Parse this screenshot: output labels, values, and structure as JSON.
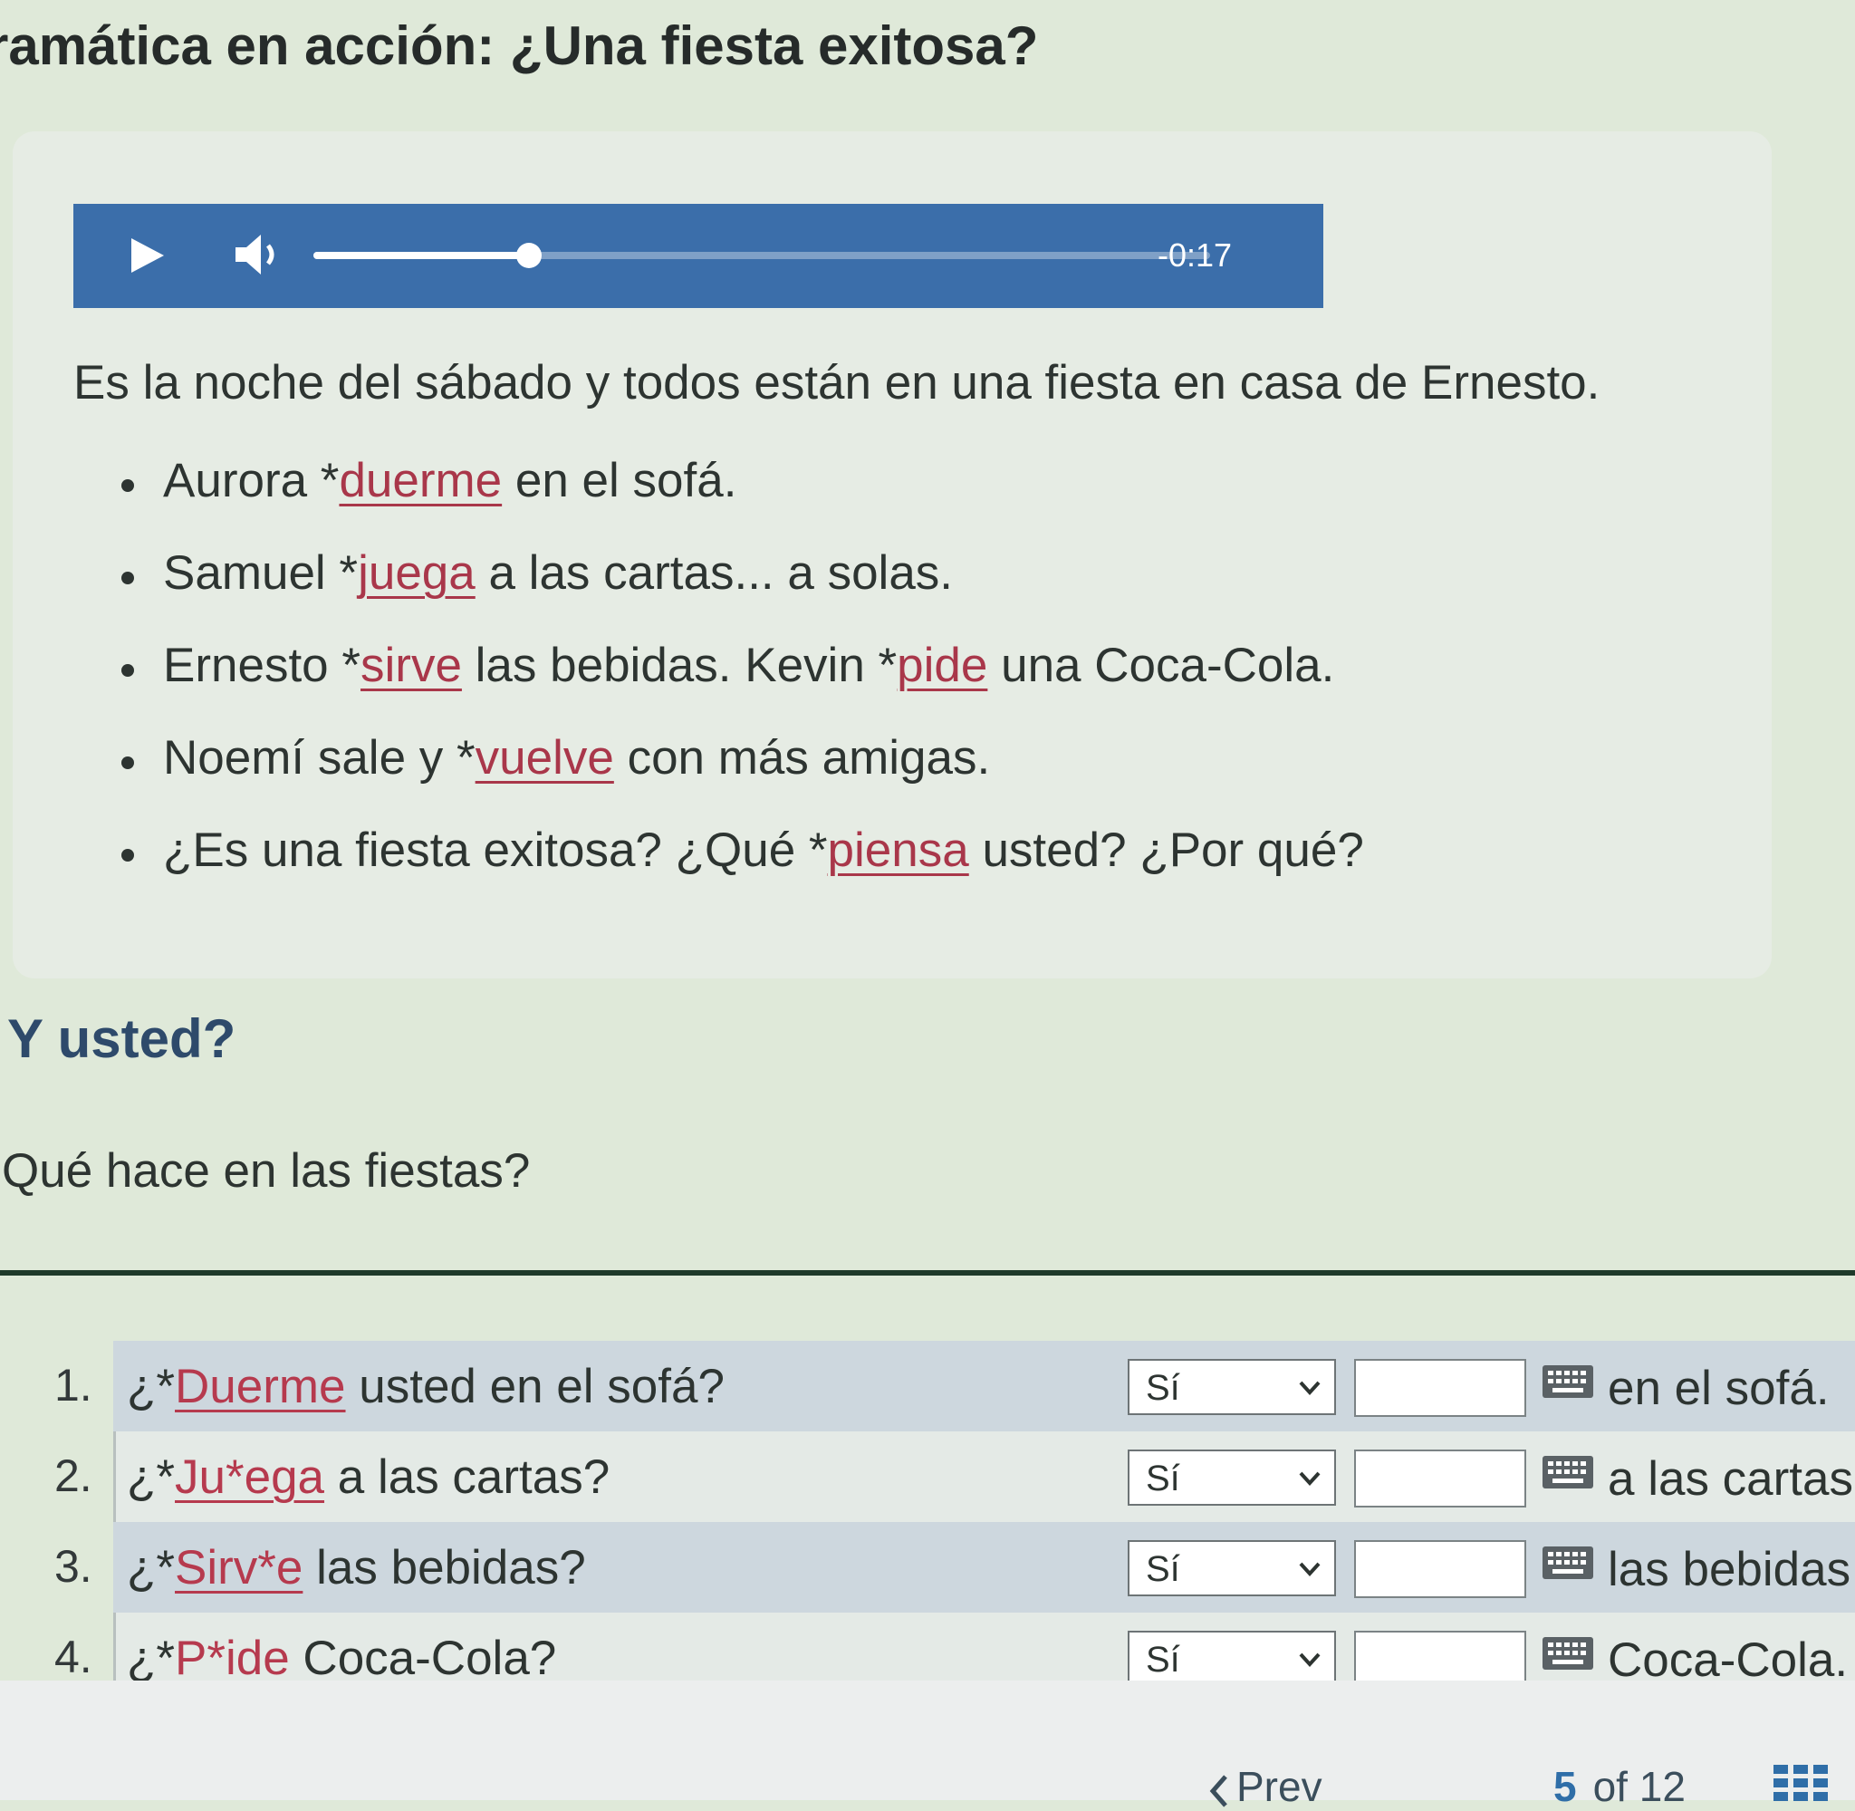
{
  "header": {
    "title": "ramática en acción: ¿Una fiesta exitosa?"
  },
  "audio": {
    "time_remaining": "-0:17",
    "progress_fraction": 0.24
  },
  "intro": "Es la noche del sábado y todos están en una fiesta en casa de Ernesto.",
  "bullets": [
    {
      "pre": "Aurora *",
      "verb1": "duerme",
      "mid": " en el sofá.",
      "verb2": "",
      "post": ""
    },
    {
      "pre": "Samuel *",
      "verb1": "juega",
      "mid": " a las cartas... a solas.",
      "verb2": "",
      "post": ""
    },
    {
      "pre": "Ernesto *",
      "verb1": "sirve",
      "mid": " las bebidas. Kevin *",
      "verb2": "pide",
      "post": " una Coca-Cola."
    },
    {
      "pre": "Noemí sale y *",
      "verb1": "vuelve",
      "mid": " con más amigas.",
      "verb2": "",
      "post": ""
    },
    {
      "pre": "¿Es una fiesta exitosa? ¿Qué *",
      "verb1": "piensa",
      "mid": " usted? ¿Por qué?",
      "verb2": "",
      "post": ""
    }
  ],
  "section": {
    "heading": "Y usted?",
    "question": "Qué hace en las fiestas?"
  },
  "rows": [
    {
      "num": "1.",
      "pre": "¿*",
      "verb": "Duerme",
      "rest": " usted en el sofá?",
      "select": "Sí",
      "suffix": "en el sofá."
    },
    {
      "num": "2.",
      "pre": "¿*",
      "verb": "Ju*ega",
      "rest": " a las cartas?",
      "select": "Sí",
      "suffix": "a las cartas"
    },
    {
      "num": "3.",
      "pre": "¿*",
      "verb": "Sirv*e",
      "rest": " las bebidas?",
      "select": "Sí",
      "suffix": "las bebidas"
    },
    {
      "num": "4.",
      "pre": "¿*",
      "verb": "P*ide",
      "rest": " Coca-Cola?",
      "select": "Sí",
      "suffix": "Coca-Cola."
    }
  ],
  "footer": {
    "prev_label": "Prev",
    "page_current": "5",
    "page_of": "of 12"
  },
  "colors": {
    "audio_bar": "#3b6eaa",
    "verb_link": "#a9374a",
    "heading": "#2e4a6b"
  },
  "icons": [
    "play-icon",
    "volume-icon",
    "keyboard-icon",
    "chevron-down-icon",
    "chevron-left-icon",
    "grid-icon"
  ]
}
